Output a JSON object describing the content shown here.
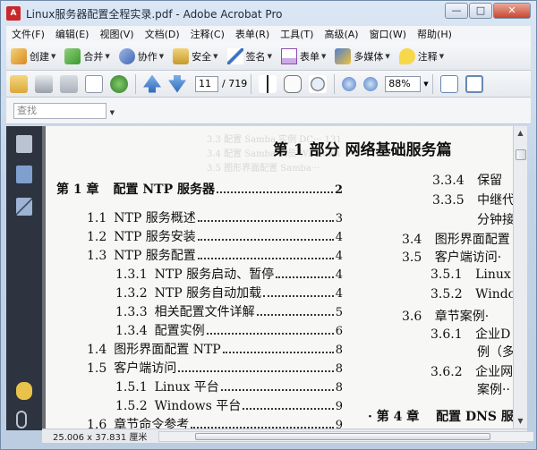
{
  "window": {
    "title": "Linux服务器配置全程实录.pdf - Adobe Acrobat Pro",
    "minimize": "—",
    "restore": "□",
    "close": "✕"
  },
  "menu": [
    "文件(F)",
    "编辑(E)",
    "视图(V)",
    "文档(D)",
    "注释(C)",
    "表单(R)",
    "工具(T)",
    "高级(A)",
    "窗口(W)",
    "帮助(H)"
  ],
  "toolbar1": {
    "create": "创建",
    "combine": "合并",
    "collaborate": "协作",
    "secure": "安全",
    "sign": "签名",
    "forms": "表单",
    "multimedia": "多媒体",
    "comment": "注释"
  },
  "toolbar2": {
    "page_current": "11",
    "page_total": "/ 719",
    "zoom": "88%"
  },
  "toolbar3": {
    "find_placeholder": "查找"
  },
  "document": {
    "part_title": "第 1 部分   网络基础服务篇",
    "toc_left": [
      {
        "num": "第 1 章",
        "text": "配置 NTP 服务器",
        "page": "2"
      },
      {
        "num": "1.1",
        "text": "NTP 服务概述",
        "page": "3"
      },
      {
        "num": "1.2",
        "text": "NTP 服务安装",
        "page": "4"
      },
      {
        "num": "1.3",
        "text": "NTP 服务配置",
        "page": "4"
      },
      {
        "num": "1.3.1",
        "text": "NTP 服务启动、暂停",
        "page": "4"
      },
      {
        "num": "1.3.2",
        "text": "NTP 服务自动加载",
        "page": "4"
      },
      {
        "num": "1.3.3",
        "text": "相关配置文件详解",
        "page": "5"
      },
      {
        "num": "1.3.4",
        "text": "配置实例",
        "page": "6"
      },
      {
        "num": "1.4",
        "text": "图形界面配置 NTP",
        "page": "8"
      },
      {
        "num": "1.5",
        "text": "客户端访问",
        "page": "8"
      },
      {
        "num": "1.5.1",
        "text": "Linux 平台",
        "page": "8"
      },
      {
        "num": "1.5.2",
        "text": "Windows 平台",
        "page": "9"
      },
      {
        "num": "1.6",
        "text": "章节命令参考",
        "page": "9"
      }
    ],
    "toc_right": [
      {
        "num": "3.3.4",
        "text": "保留"
      },
      {
        "num": "3.3.5",
        "text": "中继代"
      },
      {
        "num": "",
        "text": "分钟接"
      },
      {
        "num": "3.4",
        "text": "图形界面配置"
      },
      {
        "num": "3.5",
        "text": "客户端访问·"
      },
      {
        "num": "3.5.1",
        "text": "Linux"
      },
      {
        "num": "3.5.2",
        "text": "Windo"
      },
      {
        "num": "3.6",
        "text": "章节案例·"
      },
      {
        "num": "3.6.1",
        "text": "企业D"
      },
      {
        "num": "",
        "text": "例（多"
      },
      {
        "num": "3.6.2",
        "text": "企业网"
      },
      {
        "num": "",
        "text": "案例··"
      },
      {
        "num": "· 第 4 章",
        "text": "配置 DNS 服"
      }
    ],
    "ghost_lines": [
      "3.3 配置 Samba 实例 DC··· 131",
      "3.4 配置 Samba 成员 Windows",
      "3.5 图形界面配置 Samba···"
    ]
  },
  "status": {
    "dimensions": "25.006 x 37.831 厘米"
  }
}
